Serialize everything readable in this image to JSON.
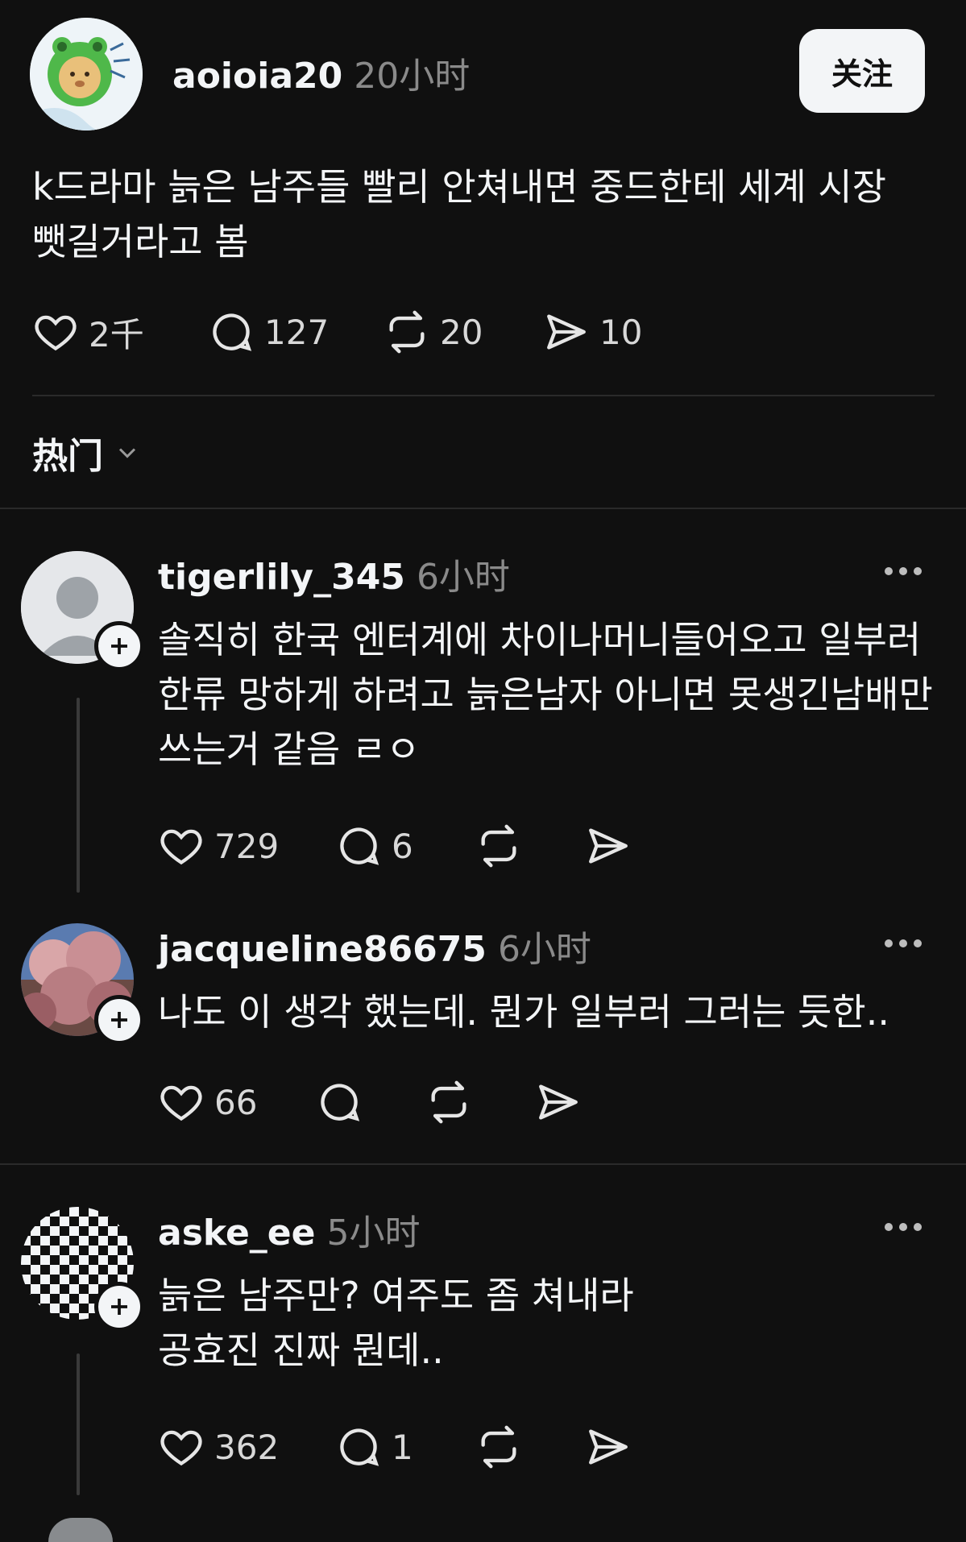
{
  "post": {
    "username": "aoioia20",
    "time": "20小时",
    "follow_label": "关注",
    "text": "k드라마 늙은 남주들 빨리 안쳐내면 중드한테 세계 시장 뺏길거라고 봄",
    "likes": "2千",
    "replies": "127",
    "reposts": "20",
    "shares": "10"
  },
  "sort": {
    "label": "热门"
  },
  "comments": [
    {
      "username": "tigerlily_345",
      "time": "6小时",
      "text": "솔직히 한국 엔터계에 차이나머니들어오고 일부러 한류 망하게 하려고 늙은남자 아니면 못생긴남배만 쓰는거 같음 ㄹㅇ",
      "likes": "729",
      "replies": "6"
    },
    {
      "username": "jacqueline86675",
      "time": "6小时",
      "text": "나도 이 생각 했는데. 뭔가 일부러 그러는 듯한..",
      "likes": "66",
      "replies": ""
    },
    {
      "username": "aske_ee",
      "time": "5小时",
      "text": "늙은 남주만? 여주도 좀 쳐내라\n공효진 진짜 뭔데..",
      "likes": "362",
      "replies": "1"
    }
  ],
  "icons": [
    "heart-icon",
    "comment-icon",
    "repost-icon",
    "share-icon",
    "chevron-down-icon",
    "more-icon",
    "plus-icon"
  ],
  "colors": {
    "background": "#101010",
    "text": "#f3f5f7",
    "muted": "#8a8a8a",
    "divider": "#2a2a2a"
  }
}
